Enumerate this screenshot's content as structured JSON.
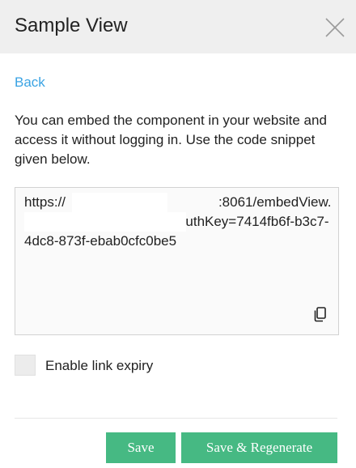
{
  "dialog": {
    "title": "Sample View",
    "back_label": "Back",
    "description": "You can embed the component in your website and access it without logging in. Use the code snippet given below.",
    "embed_code": "https://                                        :8061/embedView.do?type=cctv&cctvID=1&authKey=7414fb6f-b3c7-4dc8-873f-ebab0cfc0be5",
    "link_expiry_label": "Enable link expiry",
    "link_expiry_checked": false,
    "save_label": "Save",
    "save_regenerate_label": "Save & Regenerate"
  },
  "colors": {
    "header_bg": "#efefef",
    "link": "#3aa3e3",
    "primary_button": "#46b983"
  },
  "icons": {
    "close": "close-icon",
    "copy": "copy-icon"
  }
}
